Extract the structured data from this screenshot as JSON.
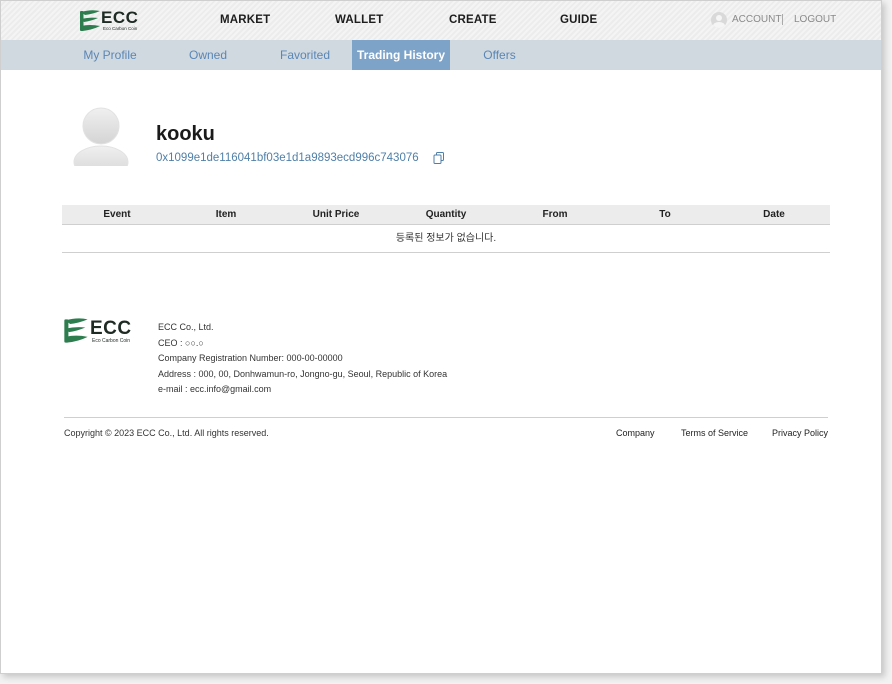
{
  "brand": {
    "name": "ECC",
    "tagline": "Eco Carbon Coin",
    "accent": "#2e7d4f"
  },
  "nav": {
    "market": "MARKET",
    "wallet": "WALLET",
    "create": "CREATE",
    "guide": "GUIDE",
    "account": "ACCOUNT",
    "logout": "LOGOUT"
  },
  "tabs": [
    {
      "label": "My Profile"
    },
    {
      "label": "Owned"
    },
    {
      "label": "Favorited"
    },
    {
      "label": "Trading History",
      "active": true
    },
    {
      "label": "Offers"
    }
  ],
  "profile": {
    "username": "kooku",
    "wallet_address": "0x1099e1de116041bf03e1d1a9893ecd996c743076"
  },
  "table": {
    "columns": [
      "Event",
      "Item",
      "Unit Price",
      "Quantity",
      "From",
      "To",
      "Date"
    ],
    "empty_message": "등록된 정보가 없습니다."
  },
  "footer": {
    "company": "ECC Co., Ltd.",
    "ceo": "CEO : ○○.○",
    "registration": "Company Registration Number: 000-00-00000",
    "address": "Address : 000, 00, Donhwamun-ro, Jongno-gu, Seoul, Republic of Korea",
    "email": "e-mail : ecc.info@gmail.com",
    "copyright": "Copyright © 2023 ECC Co., Ltd. All rights reserved.",
    "links": [
      "Company",
      "Terms of Service",
      "Privacy Policy"
    ]
  }
}
